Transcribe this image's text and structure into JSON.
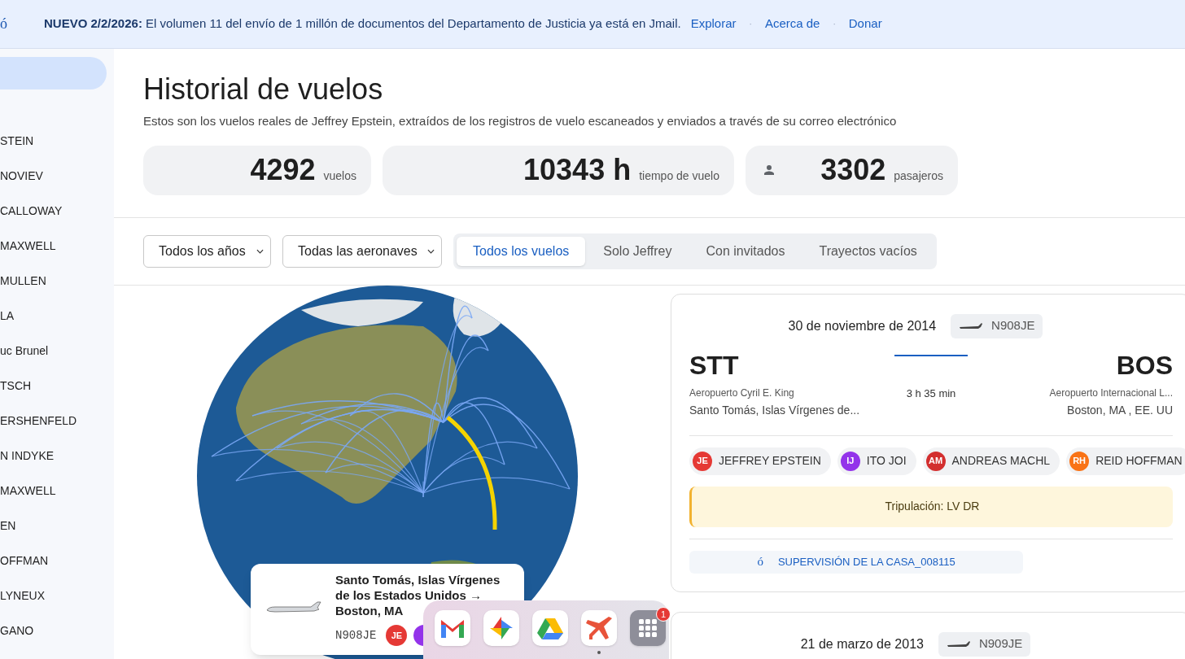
{
  "banner": {
    "icon_glyph": "ó",
    "text": "**NUEVO 2/2/2026:** El volumen 11 del envío de 1 millón de documentos del Departamento de Justicia ya está en Jmail.",
    "links": [
      "Explorar",
      "Acerca de",
      "Donar"
    ],
    "separator": "·"
  },
  "sidebar": {
    "nav_items": [
      {
        "selected": true
      }
    ],
    "people": [
      "STEIN",
      "NOVIEV",
      "CALLOWAY",
      "MAXWELL",
      "MULLEN",
      "LA",
      "uc Brunel",
      "TSCH",
      "ERSHENFELD",
      "N INDYKE",
      "MAXWELL",
      "EN",
      "OFFMAN",
      "LYNEUX",
      "GANO"
    ]
  },
  "page": {
    "title": "Historial de vuelos",
    "subtitle": "Estos son los vuelos reales de Jeffrey Epstein, extraídos de los registros de vuelo escaneados y enviados a través de su correo electrónico"
  },
  "stats": [
    {
      "value": "4292",
      "label": "vuelos",
      "icon": false
    },
    {
      "value": "10343 h",
      "label": "tiempo de vuelo",
      "icon": false
    },
    {
      "value": "3302",
      "label": "pasajeros",
      "icon": true
    }
  ],
  "filters": {
    "selects": [
      "Todos los años",
      "Todas las aeronaves"
    ],
    "tabs": [
      {
        "label": "Todos los vuelos",
        "selected": true
      },
      {
        "label": "Solo Jeffrey",
        "selected": false
      },
      {
        "label": "Con invitados",
        "selected": false
      },
      {
        "label": "Trayectos vacíos",
        "selected": false
      }
    ]
  },
  "map_popup": {
    "title": "Santo Tomás, Islas Vírgenes de los Estados Unidos → Boston, MA",
    "registration": "N908JE",
    "avatars": [
      {
        "initials": "JE",
        "color": "#e53935"
      },
      {
        "color": "#9333ea"
      }
    ]
  },
  "flights": [
    {
      "date": "30 de noviembre de 2014",
      "registration": "N908JE",
      "from": {
        "code": "STT",
        "airport": "Aeropuerto Cyril E. King",
        "city": "Santo Tomás, Islas Vírgenes de..."
      },
      "to": {
        "code": "BOS",
        "airport": "Aeropuerto Internacional L...",
        "city": "Boston, MA , EE. UU"
      },
      "duration": "3 h 35 min",
      "passengers": [
        {
          "initials": "JE",
          "name": "JEFFREY EPSTEIN",
          "color": "#e53935"
        },
        {
          "initials": "IJ",
          "name": "ITO JOI",
          "color": "#9333ea"
        },
        {
          "initials": "AM",
          "name": "ANDREAS MACHL",
          "color": "#d32f2f"
        },
        {
          "initials": "RH",
          "name": "REID HOFFMAN",
          "color": "#f97316"
        }
      ],
      "crew": "Tripulación: LV DR",
      "source_glyph": "ó",
      "source": "SUPERVISIÓN DE LA CASA_008115"
    },
    {
      "date": "21 de marzo de 2013",
      "registration": "N909JE"
    }
  ],
  "dock": {
    "apps": [
      {
        "kind": "mail",
        "active": false
      },
      {
        "kind": "pinwheel",
        "active": false
      },
      {
        "kind": "drive",
        "active": false
      },
      {
        "kind": "plane",
        "active": true
      },
      {
        "kind": "grid",
        "active": false,
        "badge": "1"
      }
    ]
  }
}
